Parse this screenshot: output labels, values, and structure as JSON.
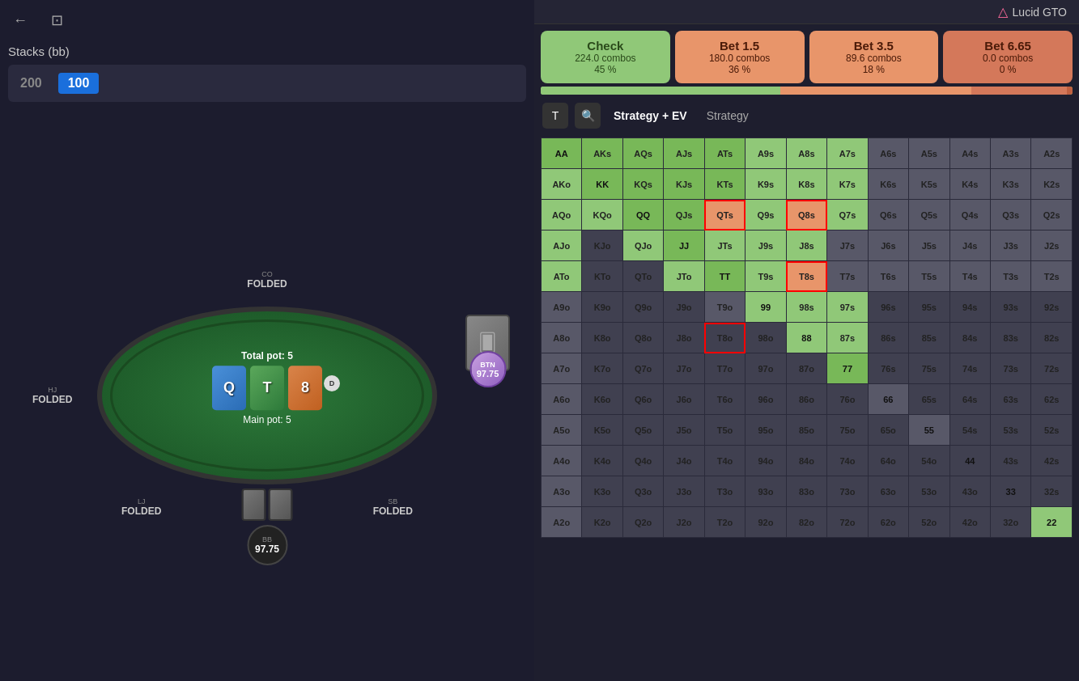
{
  "app": {
    "title": "Lucid GTO",
    "logo_icon": "△"
  },
  "left_panel": {
    "back_button": "←",
    "bookmark_button": "⊡",
    "stacks_label": "Stacks (bb)",
    "stack1": "200",
    "stack2": "100"
  },
  "poker_table": {
    "total_pot": "Total pot: 5",
    "main_pot": "Main pot: 5",
    "community_cards": [
      "Q",
      "T",
      "8"
    ],
    "positions": {
      "co": {
        "tag": "CO",
        "status": "FOLDED"
      },
      "hj": {
        "tag": "HJ",
        "status": "FOLDED"
      },
      "lj": {
        "tag": "LJ",
        "status": "FOLDED"
      },
      "sb": {
        "tag": "SB",
        "status": "FOLDED"
      },
      "btn": {
        "tag": "BTN",
        "amount": "97.75"
      },
      "bb": {
        "tag": "BB",
        "amount": "97.75"
      }
    }
  },
  "actions": {
    "check": {
      "label": "Check",
      "combos": "224.0 combos",
      "pct": "45 %"
    },
    "bet15": {
      "label": "Bet 1.5",
      "combos": "180.0 combos",
      "pct": "36 %"
    },
    "bet35": {
      "label": "Bet 3.5",
      "combos": "89.6 combos",
      "pct": "18 %"
    },
    "bet665": {
      "label": "Bet 6.65",
      "combos": "0.0 combos",
      "pct": "0 %"
    }
  },
  "view": {
    "text_icon": "T",
    "search_icon": "🔍",
    "strategy_ev_label": "Strategy + EV",
    "strategy_label": "Strategy"
  },
  "grid": {
    "rows": [
      [
        "AA",
        "AKs",
        "AQs",
        "AJs",
        "ATs",
        "A9s",
        "A8s",
        "A7s",
        "A6s",
        "A5s",
        "A4s",
        "A3s",
        "A2s"
      ],
      [
        "AKo",
        "KK",
        "KQs",
        "KJs",
        "KTs",
        "K9s",
        "K8s",
        "K7s",
        "K6s",
        "K5s",
        "K4s",
        "K3s",
        "K2s"
      ],
      [
        "AQo",
        "KQo",
        "QQ",
        "QJs",
        "QTs",
        "Q9s",
        "Q8s",
        "Q7s",
        "Q6s",
        "Q5s",
        "Q4s",
        "Q3s",
        "Q2s"
      ],
      [
        "AJo",
        "KJo",
        "QJo",
        "JJ",
        "JTs",
        "J9s",
        "J8s",
        "J7s",
        "J6s",
        "J5s",
        "J4s",
        "J3s",
        "J2s"
      ],
      [
        "ATo",
        "KTo",
        "QTo",
        "JTo",
        "TT",
        "T9s",
        "T8s",
        "T7s",
        "T6s",
        "T5s",
        "T4s",
        "T3s",
        "T2s"
      ],
      [
        "A9o",
        "K9o",
        "Q9o",
        "J9o",
        "T9o",
        "99",
        "98s",
        "97s",
        "96s",
        "95s",
        "94s",
        "93s",
        "92s"
      ],
      [
        "A8o",
        "K8o",
        "Q8o",
        "J8o",
        "T8o",
        "98o",
        "88",
        "87s",
        "86s",
        "85s",
        "84s",
        "83s",
        "82s"
      ],
      [
        "A7o",
        "K7o",
        "Q7o",
        "J7o",
        "T7o",
        "97o",
        "87o",
        "77",
        "76s",
        "75s",
        "74s",
        "73s",
        "72s"
      ],
      [
        "A6o",
        "K6o",
        "Q6o",
        "J6o",
        "T6o",
        "96o",
        "86o",
        "76o",
        "66",
        "65s",
        "64s",
        "63s",
        "62s"
      ],
      [
        "A5o",
        "K5o",
        "Q5o",
        "J5o",
        "T5o",
        "95o",
        "85o",
        "75o",
        "65o",
        "55",
        "54s",
        "53s",
        "52s"
      ],
      [
        "A4o",
        "K4o",
        "Q4o",
        "J4o",
        "T4o",
        "94o",
        "84o",
        "74o",
        "64o",
        "54o",
        "44",
        "43s",
        "42s"
      ],
      [
        "A3o",
        "K3o",
        "Q3o",
        "J3o",
        "T3o",
        "93o",
        "83o",
        "73o",
        "63o",
        "53o",
        "43o",
        "33",
        "32s"
      ],
      [
        "A2o",
        "K2o",
        "Q2o",
        "J2o",
        "T2o",
        "92o",
        "82o",
        "72o",
        "62o",
        "52o",
        "42o",
        "32o",
        "22"
      ]
    ]
  }
}
